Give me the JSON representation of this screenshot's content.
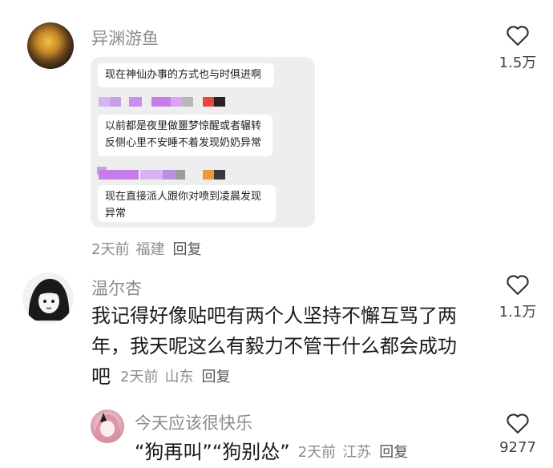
{
  "comments": [
    {
      "username": "异渊游鱼",
      "chat_card": {
        "bubbles": [
          "现在神仙办事的方式也与时俱进啊",
          "以前都是夜里做噩梦惊醒或者辗转反侧心里不安睡不着发现奶奶异常",
          "现在直接派人跟你对喷到凌晨发现异常"
        ]
      },
      "time": "2天前",
      "region": "福建",
      "reply_label": "回复",
      "likes": "1.5万"
    },
    {
      "username": "温尔杏",
      "text_line1": "我记得好像贴吧有两个人坚持不懈互骂了两",
      "text_line2": "年，我天呢这么有毅力不管干什么都会成功",
      "text_line3": "吧",
      "time": "2天前",
      "region": "山东",
      "reply_label": "回复",
      "likes": "1.1万"
    },
    {
      "username": "今天应该很快乐",
      "text": "“狗再叫”“狗别怂”",
      "time": "2天前",
      "region": "江苏",
      "reply_label": "回复",
      "likes": "9277"
    }
  ],
  "icons": {
    "like": "heart-outline-icon"
  },
  "colors": {
    "meta": "#8c8c8c",
    "chat_card_bg": "#eeeeee",
    "bubble_bg": "#ffffff"
  }
}
